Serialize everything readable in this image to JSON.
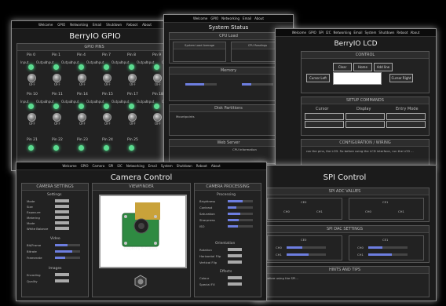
{
  "gpio": {
    "title": "BerryIO GPIO",
    "nav": [
      "Welcome",
      "GPIO",
      "Networking",
      "Email",
      "Shutdown",
      "Reboot",
      "About"
    ],
    "panel_header": "GPIO PINS",
    "rows": [
      [
        "Pin 0",
        "Pin 1",
        "Pin 4",
        "Pin 7",
        "Pin 8",
        "Pin 9"
      ],
      [
        "Pin 10",
        "Pin 11",
        "Pin 14",
        "Pin 15",
        "Pin 17",
        "Pin 18"
      ],
      [
        "Pin 21",
        "Pin 22",
        "Pin 23",
        "Pin 24",
        "Pin 25"
      ]
    ],
    "io_labels": [
      "Input",
      "Output",
      "OFF"
    ]
  },
  "status": {
    "title": "System Status",
    "panels": [
      "CPU Load",
      "System Load Average",
      "CPU Readings",
      "Memory",
      "Disk Partitions",
      "Mountpoints",
      "Web Server",
      "CPU Information"
    ]
  },
  "lcd": {
    "title": "BerryIO LCD",
    "nav": [
      "Welcome",
      "GPIO",
      "SPI",
      "I2C",
      "Networking",
      "Email",
      "System",
      "Shutdown",
      "Reboot",
      "About"
    ],
    "control_header": "CONTROL",
    "control_buttons": [
      "Clear",
      "Home",
      "Add line",
      "Cursor Left",
      "Cursor Right"
    ],
    "setup_header": "SETUP COMMANDS",
    "setup_sections": [
      "Cursor",
      "Display",
      "Entry Mode"
    ],
    "config_header": "CONFIGURATION / WIRING",
    "config_text": "ron the pins, the LCD. So before using the LCD interface, run the LCD ..."
  },
  "camera": {
    "title": "Camera Control",
    "nav": [
      "Welcome",
      "GPIO",
      "Camera",
      "SPI",
      "I2C",
      "Networking",
      "Email",
      "System",
      "Shutdown",
      "Reboot",
      "About"
    ],
    "settings_header": "CAMERA SETTINGS",
    "viewfinder_header": "VIEWFINDER",
    "processing_header": "CAMERA PROCESSING",
    "settings_groups": [
      "Settings",
      "Video",
      "Images"
    ],
    "settings_labels": [
      "Mode",
      "Size",
      "Exposure",
      "Metering",
      "Mode",
      "White Balance"
    ],
    "video_labels": [
      "Bit/Frame",
      "Bitrate",
      "Framerate"
    ],
    "image_labels": [
      "Encoding",
      "Quality"
    ],
    "processing_groups": [
      "Processing",
      "Orientation",
      "Effects"
    ],
    "processing_labels": [
      "Brightness",
      "Contrast",
      "Saturation",
      "Sharpness",
      "ISO",
      "Rotation",
      "Horizontal Flip",
      "Vertical Flip",
      "Colour",
      "Special FX"
    ],
    "levels": [
      0.6,
      0.35,
      0.5,
      0.45,
      0.4
    ],
    "board_text": "Raspberry Pi Camera"
  },
  "spi": {
    "title": "SPI Control",
    "adc_header": "SPI ADC VALUES",
    "dac_header": "SPI DAC SETTINGS",
    "channels": [
      "CE0",
      "CE1"
    ],
    "adc_rows": [
      "CH0",
      "CH1"
    ],
    "hints_header": "HINTS AND TIPS",
    "hints_text": "Before using the SPI..."
  }
}
